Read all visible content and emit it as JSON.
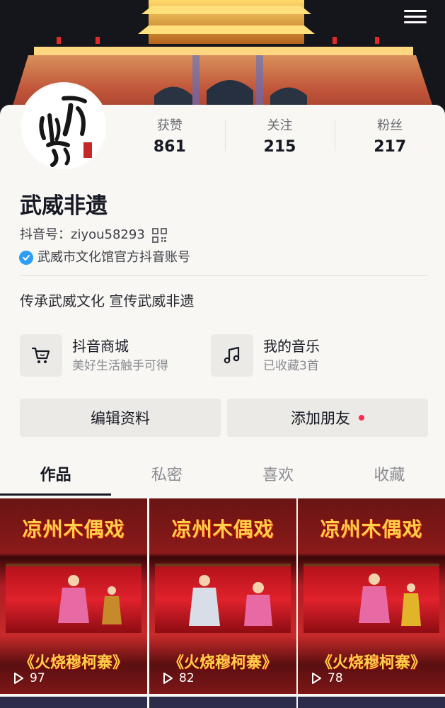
{
  "header": {
    "menu_icon": "menu-icon"
  },
  "profile": {
    "name": "武威非遗",
    "douyin_id_label": "抖音号：",
    "douyin_id": "ziyou58293",
    "verified_text": "武威市文化馆官方抖音账号",
    "bio": "传承武威文化 宣传武威非遗"
  },
  "stats": [
    {
      "label": "获赞",
      "value": "861"
    },
    {
      "label": "关注",
      "value": "215"
    },
    {
      "label": "粉丝",
      "value": "217"
    }
  ],
  "features": [
    {
      "title": "抖音商城",
      "subtitle": "美好生活触手可得",
      "icon": "cart-icon"
    },
    {
      "title": "我的音乐",
      "subtitle": "已收藏3首",
      "icon": "music-note-icon"
    }
  ],
  "buttons": {
    "edit": "编辑资料",
    "add_friend": "添加朋友"
  },
  "tabs": [
    "作品",
    "私密",
    "喜欢",
    "收藏"
  ],
  "videos": [
    {
      "title": "凉州木偶戏",
      "subtitle": "《火烧穆柯寨》",
      "plays": "97"
    },
    {
      "title": "凉州木偶戏",
      "subtitle": "《火烧穆柯寨》",
      "plays": "82"
    },
    {
      "title": "凉州木偶戏",
      "subtitle": "《火烧穆柯寨》",
      "plays": "78"
    }
  ],
  "colors": {
    "accent_red": "#fe2c55",
    "verify_blue": "#2e9ef5",
    "text_dark": "#161823"
  }
}
